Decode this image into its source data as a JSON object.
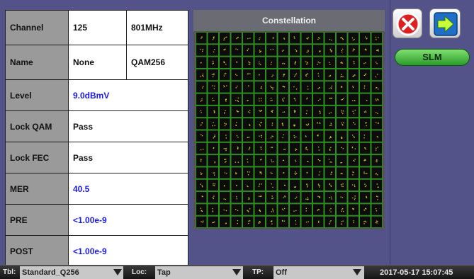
{
  "measurements": {
    "channel": {
      "label": "Channel",
      "value": "125",
      "frequency": "801MHz"
    },
    "name": {
      "label": "Name",
      "value": "None",
      "modulation": "QAM256"
    },
    "level": {
      "label": "Level",
      "value": "9.0dBmV"
    },
    "lock_qam": {
      "label": "Lock QAM",
      "value": "Pass"
    },
    "lock_fec": {
      "label": "Lock FEC",
      "value": "Pass"
    },
    "mer": {
      "label": "MER",
      "value": "40.5"
    },
    "pre": {
      "label": "PRE",
      "value": "<1.00e-9"
    },
    "post": {
      "label": "POST",
      "value": "<1.00e-9"
    }
  },
  "constellation": {
    "title": "Constellation",
    "grid_size": 16,
    "cell_color": "#0c0c0c",
    "grid_color": "#2e8f1e",
    "symbol_color": "#d8d020"
  },
  "right_panel": {
    "close_icon": "close-icon",
    "next_icon": "arrow-right-icon",
    "slm_label": "SLM"
  },
  "status_bar": {
    "tbl_label": "Tbl:",
    "tbl_value": "Standard_Q256",
    "loc_label": "Loc:",
    "loc_value": "Tap",
    "tp_label": "TP:",
    "tp_value": "Off",
    "datetime": "2017-05-17  15:07:45"
  },
  "colors": {
    "background": "#53538a",
    "label_cell": "#9a9a9a",
    "value_blue": "#1a1ae6",
    "close_red": "#e02020",
    "slm_green": "#2a9a2a"
  }
}
